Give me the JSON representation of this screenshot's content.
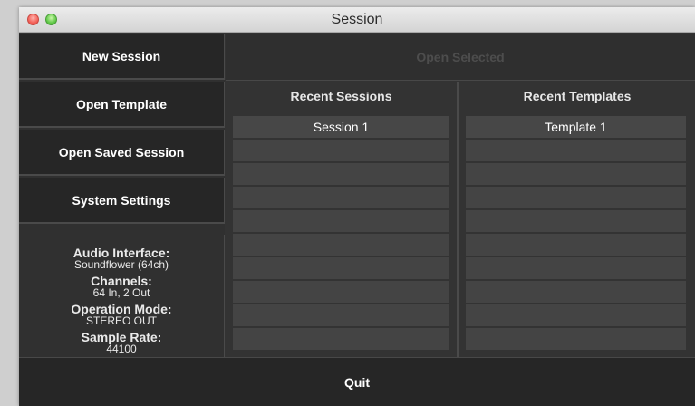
{
  "window": {
    "title": "Session"
  },
  "sidebar": {
    "buttons": [
      {
        "label": "New Session"
      },
      {
        "label": "Open Template"
      },
      {
        "label": "Open Saved Session"
      },
      {
        "label": "System Settings"
      }
    ],
    "info": {
      "audio_interface_label": "Audio Interface:",
      "audio_interface_value": "Soundflower (64ch)",
      "channels_label": "Channels:",
      "channels_value": "64 In, 2 Out",
      "operation_mode_label": "Operation Mode:",
      "operation_mode_value": "STEREO OUT",
      "sample_rate_label": "Sample Rate:",
      "sample_rate_value": "44100"
    }
  },
  "main": {
    "open_selected_label": "Open Selected",
    "recent_sessions": {
      "header": "Recent Sessions",
      "items": [
        "Session 1",
        "",
        "",
        "",
        "",
        "",
        "",
        "",
        "",
        ""
      ]
    },
    "recent_templates": {
      "header": "Recent Templates",
      "items": [
        "Template 1",
        "",
        "",
        "",
        "",
        "",
        "",
        "",
        "",
        ""
      ]
    }
  },
  "footer": {
    "quit_label": "Quit"
  }
}
